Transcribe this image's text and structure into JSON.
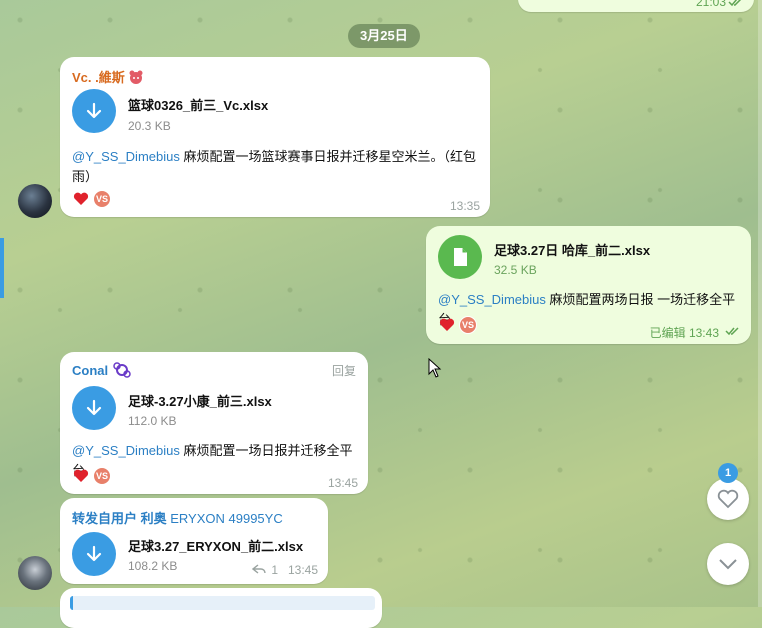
{
  "top_message": {
    "time": "21:03"
  },
  "date_divider": "3月25日",
  "msg1": {
    "sender": "Vc. .維斯",
    "file_name": "篮球0326_前三_Vc.xlsx",
    "file_size": "20.3 KB",
    "mention": "@Y_SS_Dimebius",
    "text_line1": " 麻烦配置一场篮球赛事日报并迁移星空米兰。（红包",
    "text_line2": "雨）",
    "reaction_badge": "VS",
    "time": "13:35"
  },
  "msg2": {
    "file_name": "足球3.27日 哈库_前二.xlsx",
    "file_size": "32.5 KB",
    "mention": "@Y_SS_Dimebius",
    "text": " 麻烦配置两场日报 一场迁移全平台",
    "reaction_badge": "VS",
    "time": "已编辑 13:43"
  },
  "msg3": {
    "sender": "Conal",
    "reply_label": "回复",
    "file_name": "足球-3.27小康_前三.xlsx",
    "file_size": "112.0 KB",
    "mention": "@Y_SS_Dimebius",
    "text": " 麻烦配置一场日报并迁移全平台",
    "reaction_badge": "VS",
    "time": "13:45"
  },
  "msg4": {
    "forward_prefix": "转发自用户 利奥 ",
    "forward_code": "ERYXON 49995YC",
    "file_name": "足球3.27_ERYXON_前二.xlsx",
    "file_size": "108.2 KB",
    "reply_count": "1",
    "time": "13:45"
  },
  "unread_reactions": "1",
  "colors": {
    "accent": "#3a9ce3",
    "outgoing_bubble": "#effdde",
    "reaction_heart": "#e0222c"
  },
  "icons": [
    "download-icon",
    "file-icon",
    "heart-icon",
    "chevron-down-icon",
    "reply-arrow-icon",
    "double-check-icon"
  ]
}
